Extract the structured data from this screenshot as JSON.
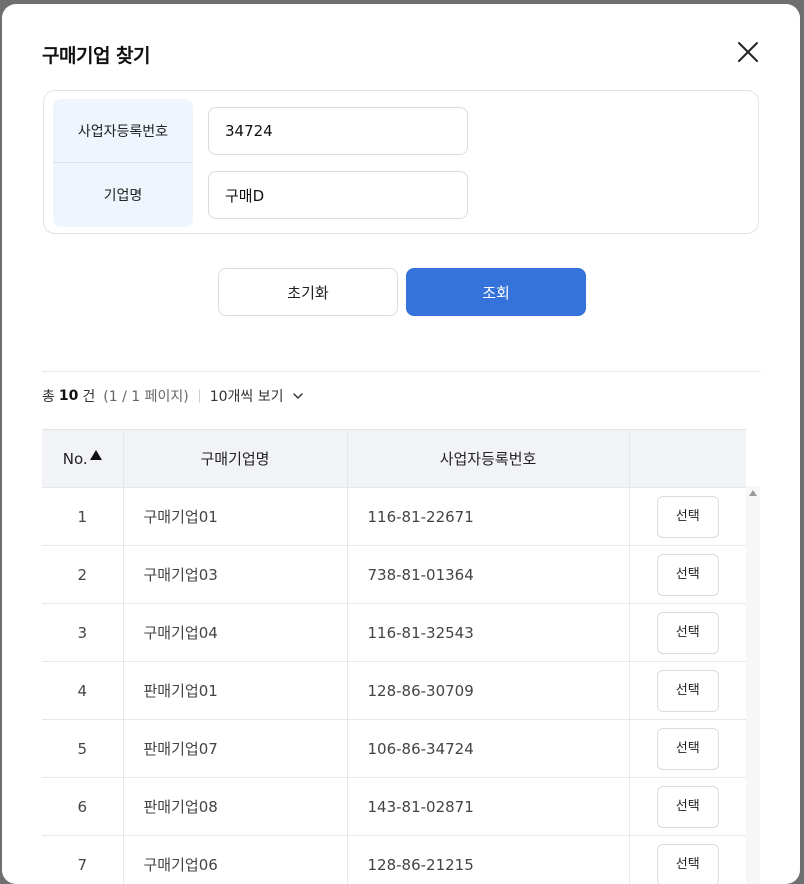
{
  "modal": {
    "title": "구매기업 찾기"
  },
  "search": {
    "reg_no_label": "사업자등록번호",
    "reg_no_value": "34724",
    "company_label": "기업명",
    "company_value": "구매D"
  },
  "buttons": {
    "reset": "초기화",
    "search": "조회"
  },
  "summary": {
    "total_prefix": "총",
    "total_count": "10",
    "total_suffix": "건",
    "page_info": "(1 / 1 페이지)",
    "per_page": "10개씩 보기"
  },
  "table": {
    "headers": [
      "No.",
      "구매기업명",
      "사업자등록번호",
      ""
    ],
    "rows": [
      {
        "no": "1",
        "name": "구매기업01",
        "reg": "116-81-22671",
        "action": "선택"
      },
      {
        "no": "2",
        "name": "구매기업03",
        "reg": "738-81-01364",
        "action": "선택"
      },
      {
        "no": "3",
        "name": "구매기업04",
        "reg": "116-81-32543",
        "action": "선택"
      },
      {
        "no": "4",
        "name": "판매기업01",
        "reg": "128-86-30709",
        "action": "선택"
      },
      {
        "no": "5",
        "name": "판매기업07",
        "reg": "106-86-34724",
        "action": "선택"
      },
      {
        "no": "6",
        "name": "판매기업08",
        "reg": "143-81-02871",
        "action": "선택"
      },
      {
        "no": "7",
        "name": "구매기업06",
        "reg": "128-86-21215",
        "action": "선택"
      }
    ]
  },
  "icons": {
    "close": "close-icon",
    "sort": "sort-ascending-icon",
    "dropdown": "chevron-down-icon"
  },
  "colors": {
    "primary": "#3573db",
    "label_bg": "#eef5fd",
    "header_bg": "#f1f3f6"
  }
}
